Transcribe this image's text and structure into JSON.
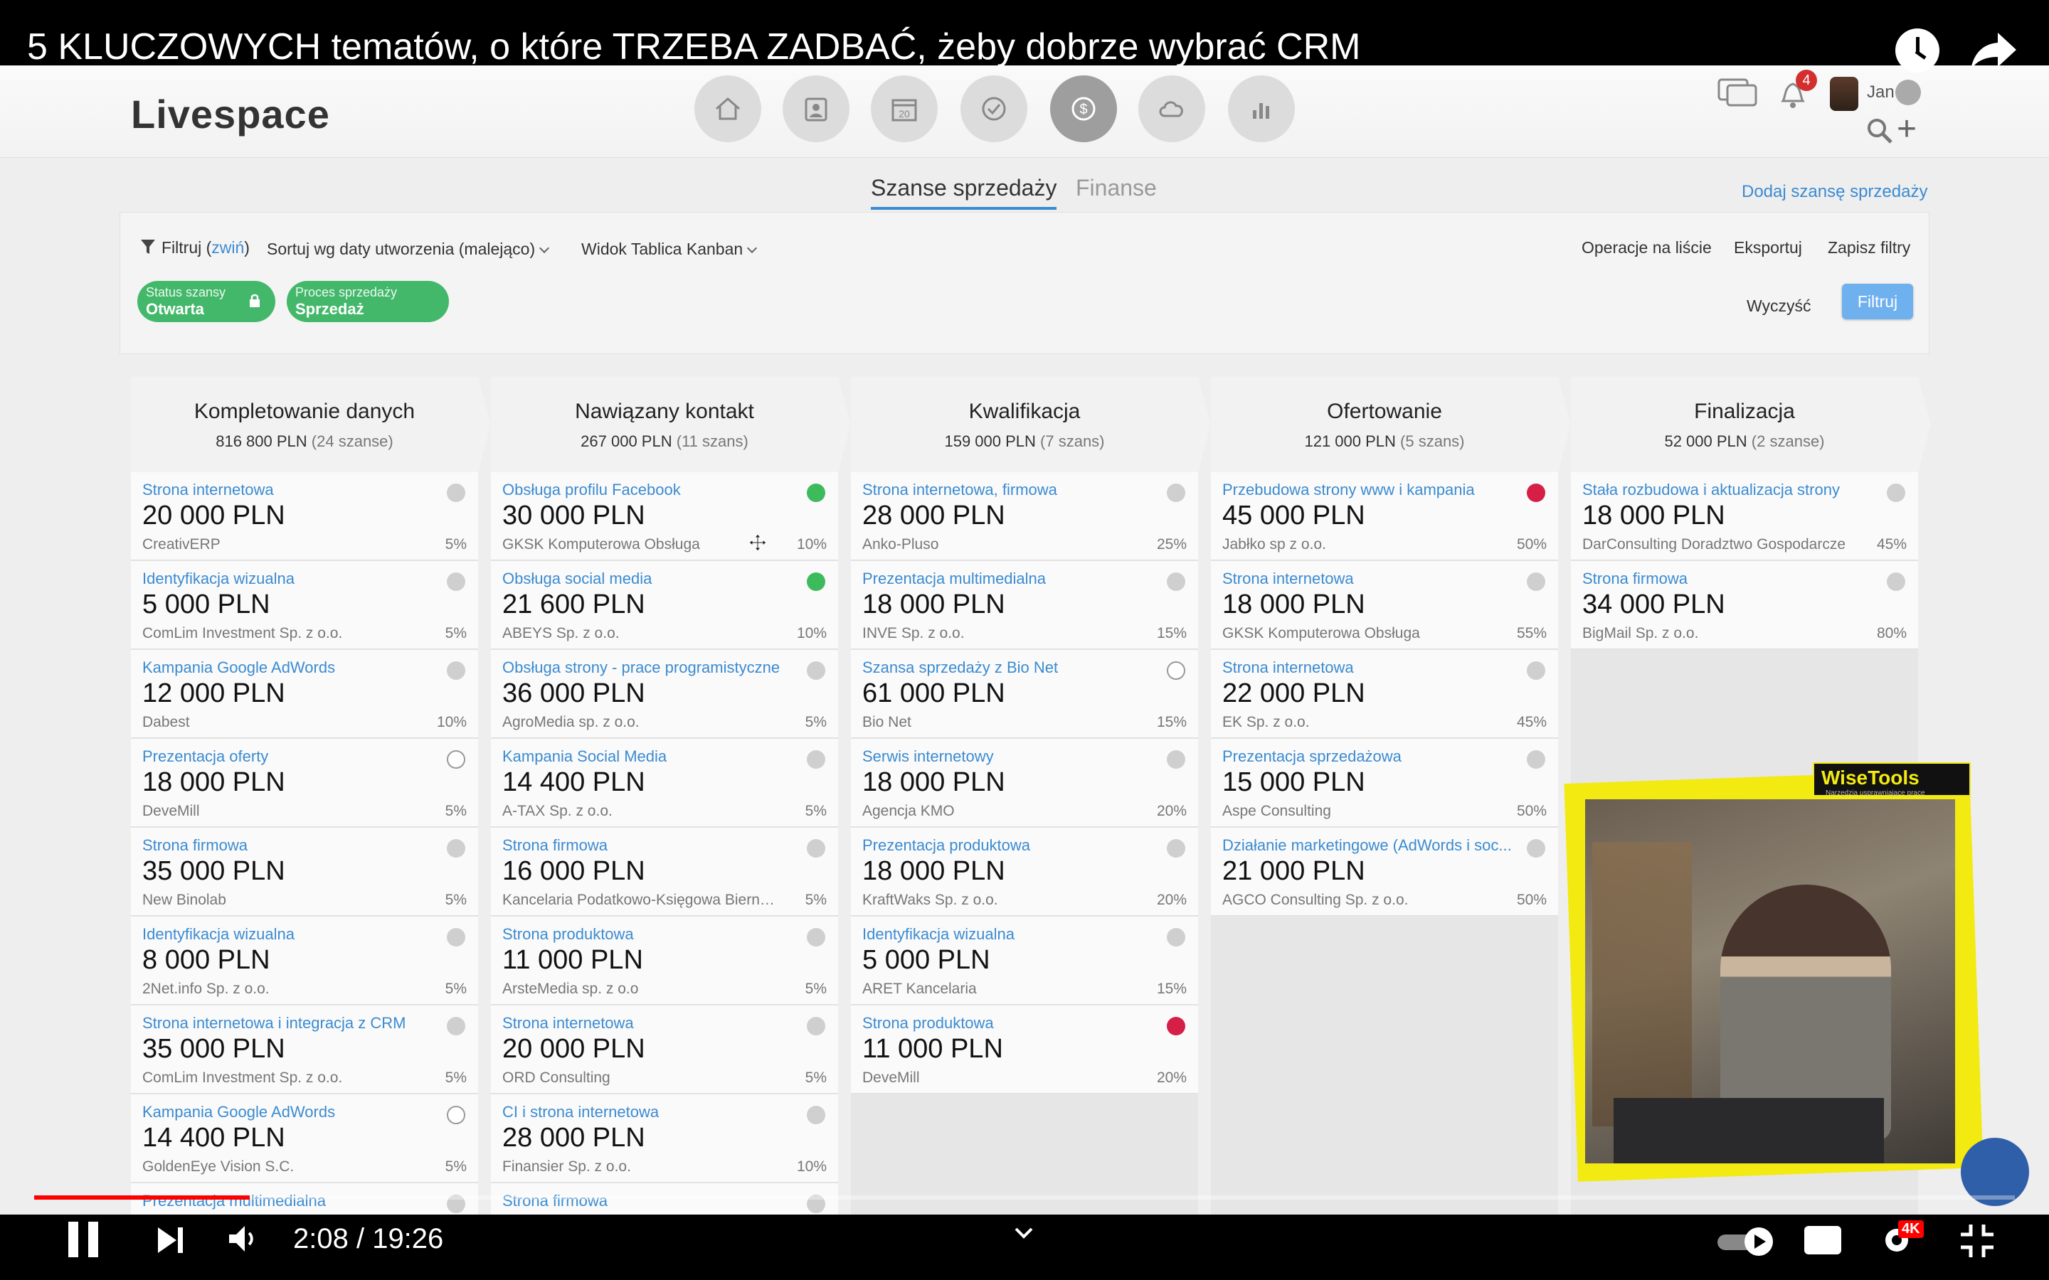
{
  "video": {
    "title": "5 KLUCZOWYCH tematów, o które TRZEBA ZADBAĆ, żeby dobrze wybrać CRM",
    "time": "2:08 / 19:26",
    "progress_fraction": 0.109,
    "quality_badge": "4K"
  },
  "app": {
    "logo": "Livespace",
    "nav": [
      "home-icon",
      "contacts-icon",
      "calendar-icon",
      "tasks-icon",
      "deals-icon",
      "cloud-icon",
      "reports-icon"
    ],
    "calendar_day": "20",
    "notifications_count": "4",
    "user_name": "Jan"
  },
  "tabs": {
    "opportunities": "Szanse sprzedaży",
    "finance": "Finanse",
    "add_opportunity": "Dodaj szansę sprzedaży"
  },
  "filters": {
    "filter_label": "Filtruj (",
    "filter_link": "zwiń",
    "filter_close": ")",
    "sort": "Sortuj wg daty utworzenia (malejąco)",
    "view": "Widok Tablica Kanban",
    "list_ops": "Operacje na liście",
    "export": "Eksportuj",
    "save_filters": "Zapisz filtry",
    "status_caption": "Status szansy",
    "status_value": "Otwarta",
    "process_caption": "Proces sprzedaży",
    "process_value": "Sprzedaż",
    "clear": "Wyczyść",
    "apply": "Filtruj"
  },
  "columns": [
    {
      "title": "Kompletowanie danych",
      "sum": "816 800 PLN",
      "count": "(24 szanse)",
      "cards": [
        {
          "name": "Strona internetowa",
          "amount": "20 000 PLN",
          "company": "CreativERP",
          "pct": "5%",
          "dot": "gray"
        },
        {
          "name": "Identyfikacja wizualna",
          "amount": "5 000 PLN",
          "company": "ComLim Investment Sp. z o.o.",
          "pct": "5%",
          "dot": "gray"
        },
        {
          "name": "Kampania Google AdWords",
          "amount": "12 000 PLN",
          "company": "Dabest",
          "pct": "10%",
          "dot": "gray"
        },
        {
          "name": "Prezentacja oferty",
          "amount": "18 000 PLN",
          "company": "DeveMill",
          "pct": "5%",
          "dot": "empty"
        },
        {
          "name": "Strona firmowa",
          "amount": "35 000 PLN",
          "company": "New Binolab",
          "pct": "5%",
          "dot": "gray"
        },
        {
          "name": "Identyfikacja wizualna",
          "amount": "8 000 PLN",
          "company": "2Net.info Sp. z o.o.",
          "pct": "5%",
          "dot": "gray"
        },
        {
          "name": "Strona internetowa i integracja z CRM",
          "amount": "35 000 PLN",
          "company": "ComLim Investment Sp. z o.o.",
          "pct": "5%",
          "dot": "gray"
        },
        {
          "name": "Kampania Google AdWords",
          "amount": "14 400 PLN",
          "company": "GoldenEye Vision S.C.",
          "pct": "5%",
          "dot": "empty"
        },
        {
          "name": "Prezentacja multimedialna",
          "amount": "",
          "company": "",
          "pct": "",
          "dot": "gray"
        }
      ]
    },
    {
      "title": "Nawiązany kontakt",
      "sum": "267 000 PLN",
      "count": "(11 szans)",
      "cards": [
        {
          "name": "Obsługa profilu Facebook",
          "amount": "30 000 PLN",
          "company": "GKSK Komputerowa Obsługa",
          "pct": "10%",
          "dot": "green"
        },
        {
          "name": "Obsługa social media",
          "amount": "21 600 PLN",
          "company": "ABEYS Sp. z o.o.",
          "pct": "10%",
          "dot": "green"
        },
        {
          "name": "Obsługa strony - prace programistyczne",
          "amount": "36 000 PLN",
          "company": "AgroMedia sp. z o.o.",
          "pct": "5%",
          "dot": "gray"
        },
        {
          "name": "Kampania Social Media",
          "amount": "14 400 PLN",
          "company": "A-TAX Sp. z o.o.",
          "pct": "5%",
          "dot": "gray"
        },
        {
          "name": "Strona firmowa",
          "amount": "16 000 PLN",
          "company": "Kancelaria Podatkowo-Księgowa Bierna...",
          "pct": "5%",
          "dot": "gray"
        },
        {
          "name": "Strona produktowa",
          "amount": "11 000 PLN",
          "company": "ArsteMedia sp. z o.o",
          "pct": "5%",
          "dot": "gray"
        },
        {
          "name": "Strona internetowa",
          "amount": "20 000 PLN",
          "company": "ORD Consulting",
          "pct": "5%",
          "dot": "gray"
        },
        {
          "name": "CI i strona internetowa",
          "amount": "28 000 PLN",
          "company": "Finansier Sp. z o.o.",
          "pct": "10%",
          "dot": "gray"
        },
        {
          "name": "Strona firmowa",
          "amount": "",
          "company": "",
          "pct": "",
          "dot": "gray"
        }
      ]
    },
    {
      "title": "Kwalifikacja",
      "sum": "159 000 PLN",
      "count": "(7 szans)",
      "cards": [
        {
          "name": "Strona internetowa, firmowa",
          "amount": "28 000 PLN",
          "company": "Anko-Pluso",
          "pct": "25%",
          "dot": "gray"
        },
        {
          "name": "Prezentacja multimedialna",
          "amount": "18 000 PLN",
          "company": "INVE Sp. z o.o.",
          "pct": "15%",
          "dot": "gray"
        },
        {
          "name": "Szansa sprzedaży z Bio Net",
          "amount": "61 000 PLN",
          "company": "Bio Net",
          "pct": "15%",
          "dot": "empty"
        },
        {
          "name": "Serwis internetowy",
          "amount": "18 000 PLN",
          "company": "Agencja KMO",
          "pct": "20%",
          "dot": "gray"
        },
        {
          "name": "Prezentacja produktowa",
          "amount": "18 000 PLN",
          "company": "KraftWaks Sp. z o.o.",
          "pct": "20%",
          "dot": "gray"
        },
        {
          "name": "Identyfikacja wizualna",
          "amount": "5 000 PLN",
          "company": "ARET Kancelaria",
          "pct": "15%",
          "dot": "gray"
        },
        {
          "name": "Strona produktowa",
          "amount": "11 000 PLN",
          "company": "DeveMill",
          "pct": "20%",
          "dot": "red"
        }
      ]
    },
    {
      "title": "Ofertowanie",
      "sum": "121 000 PLN",
      "count": "(5 szans)",
      "cards": [
        {
          "name": "Przebudowa strony www i kampania",
          "amount": "45 000 PLN",
          "company": "Jabłko sp z o.o.",
          "pct": "50%",
          "dot": "red"
        },
        {
          "name": "Strona internetowa",
          "amount": "18 000 PLN",
          "company": "GKSK Komputerowa Obsługa",
          "pct": "55%",
          "dot": "gray"
        },
        {
          "name": "Strona internetowa",
          "amount": "22 000 PLN",
          "company": "EK Sp. z o.o.",
          "pct": "45%",
          "dot": "gray"
        },
        {
          "name": "Prezentacja sprzedażowa",
          "amount": "15 000 PLN",
          "company": "Aspe Consulting",
          "pct": "50%",
          "dot": "gray"
        },
        {
          "name": "Działanie marketingowe (AdWords i soc...",
          "amount": "21 000 PLN",
          "company": "AGCO Consulting Sp. z o.o.",
          "pct": "50%",
          "dot": "gray"
        }
      ]
    },
    {
      "title": "Finalizacja",
      "sum": "52 000 PLN",
      "count": "(2 szanse)",
      "cards": [
        {
          "name": "Stała rozbudowa i aktualizacja strony",
          "amount": "18 000 PLN",
          "company": "DarConsulting Doradztwo Gospodarcze",
          "pct": "45%",
          "dot": "gray"
        },
        {
          "name": "Strona firmowa",
          "amount": "34 000 PLN",
          "company": "BigMail Sp. z o.o.",
          "pct": "80%",
          "dot": "gray"
        }
      ]
    }
  ],
  "overlay": {
    "brand": "WiseTools",
    "brand_sub": "Narzędzia usprawniające pracę"
  }
}
